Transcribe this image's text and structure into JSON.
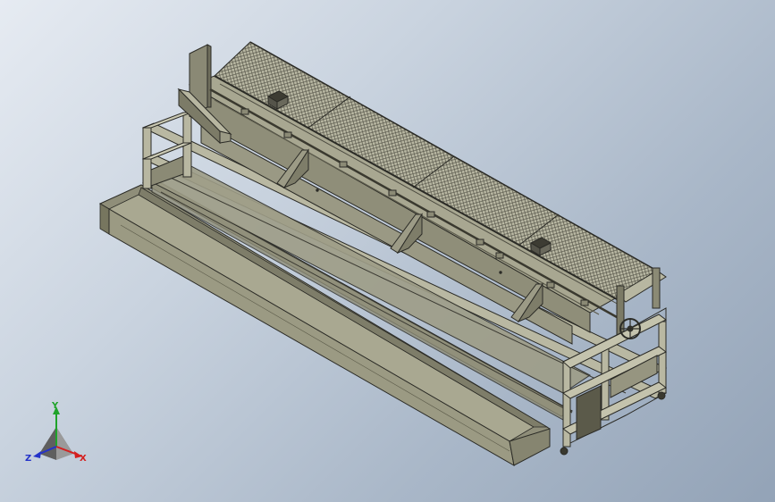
{
  "viewport": {
    "background_top": "#e6ebf2",
    "background_bottom": "#93a3b7",
    "model_color": "#a7a68e",
    "model_dark": "#6f6e5c",
    "edge_color": "#2b2b26"
  },
  "triad": {
    "x_label": "X",
    "y_label": "Y",
    "z_label": "Z",
    "x_color": "#d42020",
    "y_color": "#1fa32a",
    "z_color": "#2433c9"
  }
}
